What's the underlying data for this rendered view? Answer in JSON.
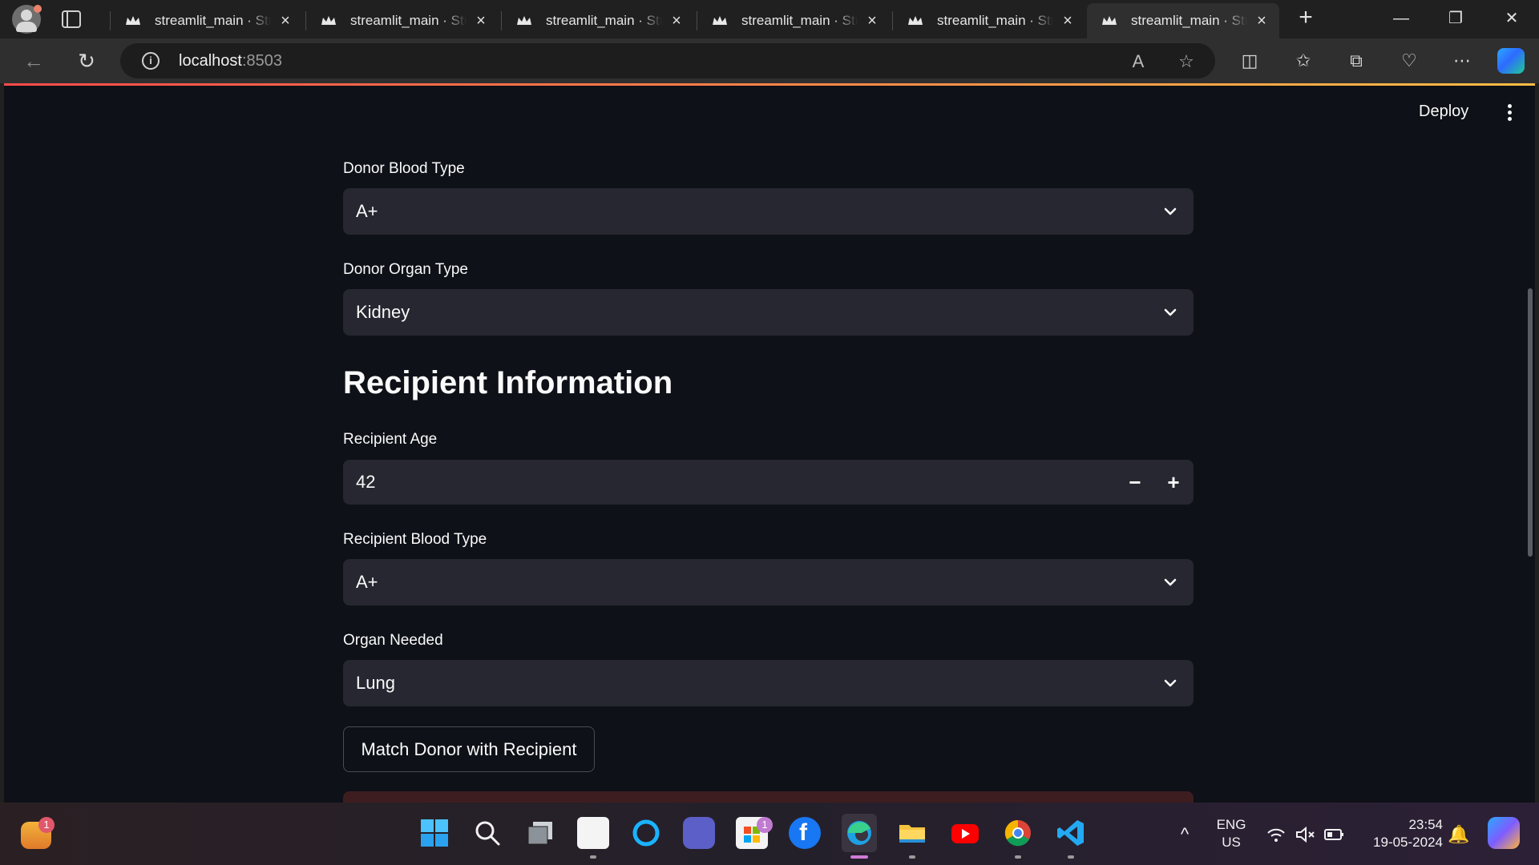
{
  "browser": {
    "tabs": [
      {
        "title": "streamlit_main · Streamlit",
        "close": "×"
      },
      {
        "title": "streamlit_main · Streamlit",
        "close": "×"
      },
      {
        "title": "streamlit_main · Streamlit",
        "close": "×"
      },
      {
        "title": "streamlit_main · Streamlit",
        "close": "×"
      },
      {
        "title": "streamlit_main · Streamlit",
        "close": "×"
      },
      {
        "title": "streamlit_main · Streamlit",
        "close": "×",
        "active": true
      }
    ],
    "new_tab": "+",
    "window_controls": {
      "minimize": "—",
      "restore": "❐",
      "close": "✕"
    },
    "address": {
      "host": "localhost",
      "port": ":8503"
    },
    "icons": [
      "back-icon",
      "refresh-icon",
      "site-info-icon",
      "read-aloud-icon",
      "favorite-star-icon",
      "split-screen-icon",
      "favorites-icon",
      "collections-icon",
      "browser-essentials-icon",
      "more-icon",
      "copilot-icon"
    ]
  },
  "app": {
    "deploy_label": "Deploy",
    "donor_blood_type": {
      "label": "Donor Blood Type",
      "value": "A+"
    },
    "donor_organ_type": {
      "label": "Donor Organ Type",
      "value": "Kidney"
    },
    "recipient_section_title": "Recipient Information",
    "recipient_age": {
      "label": "Recipient Age",
      "value": "42",
      "minus": "−",
      "plus": "+"
    },
    "recipient_blood_type": {
      "label": "Recipient Blood Type",
      "value": "A+"
    },
    "organ_needed": {
      "label": "Organ Needed",
      "value": "Lung"
    },
    "match_button": "Match Donor with Recipient",
    "accent_colors": {
      "gradient_start": "#ff4b4b",
      "gradient_end": "#ffbd45",
      "background": "#0e1117",
      "widget_bg": "#262730"
    }
  },
  "taskbar": {
    "weather_badge": "1",
    "store_badge": "1",
    "apps": [
      "weather-icon",
      "start-icon",
      "search-icon",
      "task-view-icon",
      "unstop-icon",
      "cortana-icon",
      "teams-icon",
      "store-icon",
      "facebook-icon",
      "edge-icon",
      "file-explorer-icon",
      "youtube-icon",
      "chrome-icon",
      "vscode-icon"
    ],
    "language": {
      "line1": "ENG",
      "line2": "US"
    },
    "clock": {
      "time": "23:54",
      "date": "19-05-2024"
    },
    "tray_chevron": "^"
  }
}
